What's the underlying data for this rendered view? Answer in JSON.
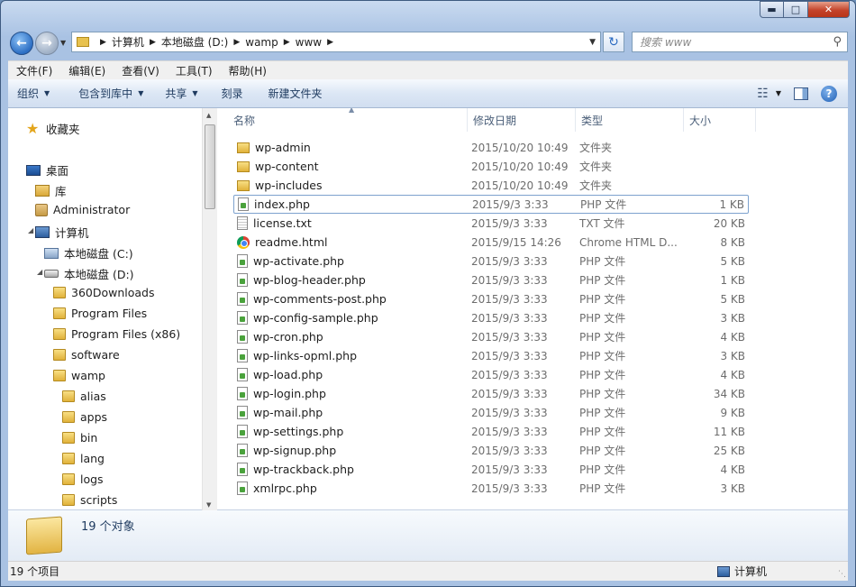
{
  "window": {
    "minimize_icon": "minimize-icon",
    "maximize_icon": "maximize-icon",
    "close_icon": "close-icon"
  },
  "address": {
    "crumbs": [
      "计算机",
      "本地磁盘 (D:)",
      "wamp",
      "www"
    ]
  },
  "search": {
    "placeholder": "搜索 www"
  },
  "menubar": [
    "文件(F)",
    "编辑(E)",
    "查看(V)",
    "工具(T)",
    "帮助(H)"
  ],
  "toolbar": {
    "organize": "组织",
    "include_library": "包含到库中",
    "share": "共享",
    "burn": "刻录",
    "new_folder": "新建文件夹"
  },
  "navpane": {
    "favorites": "收藏夹",
    "desktop": "桌面",
    "libraries": "库",
    "administrator": "Administrator",
    "computer": "计算机",
    "drive_c": "本地磁盘 (C:)",
    "drive_d": "本地磁盘 (D:)",
    "d_folders": [
      "360Downloads",
      "Program Files",
      "Program Files (x86)",
      "software",
      "wamp"
    ],
    "wamp_folders": [
      "alias",
      "apps",
      "bin",
      "lang",
      "logs",
      "scripts"
    ]
  },
  "columns": {
    "name": "名称",
    "date": "修改日期",
    "type": "类型",
    "size": "大小"
  },
  "files": [
    {
      "icon": "folder",
      "name": "wp-admin",
      "date": "2015/10/20 10:49",
      "type": "文件夹",
      "size": ""
    },
    {
      "icon": "folder",
      "name": "wp-content",
      "date": "2015/10/20 10:49",
      "type": "文件夹",
      "size": ""
    },
    {
      "icon": "folder",
      "name": "wp-includes",
      "date": "2015/10/20 10:49",
      "type": "文件夹",
      "size": ""
    },
    {
      "icon": "php",
      "name": "index.php",
      "date": "2015/9/3 3:33",
      "type": "PHP 文件",
      "size": "1 KB"
    },
    {
      "icon": "txt",
      "name": "license.txt",
      "date": "2015/9/3 3:33",
      "type": "TXT 文件",
      "size": "20 KB"
    },
    {
      "icon": "chrome",
      "name": "readme.html",
      "date": "2015/9/15 14:26",
      "type": "Chrome HTML D...",
      "size": "8 KB"
    },
    {
      "icon": "php",
      "name": "wp-activate.php",
      "date": "2015/9/3 3:33",
      "type": "PHP 文件",
      "size": "5 KB"
    },
    {
      "icon": "php",
      "name": "wp-blog-header.php",
      "date": "2015/9/3 3:33",
      "type": "PHP 文件",
      "size": "1 KB"
    },
    {
      "icon": "php",
      "name": "wp-comments-post.php",
      "date": "2015/9/3 3:33",
      "type": "PHP 文件",
      "size": "5 KB"
    },
    {
      "icon": "php",
      "name": "wp-config-sample.php",
      "date": "2015/9/3 3:33",
      "type": "PHP 文件",
      "size": "3 KB"
    },
    {
      "icon": "php",
      "name": "wp-cron.php",
      "date": "2015/9/3 3:33",
      "type": "PHP 文件",
      "size": "4 KB"
    },
    {
      "icon": "php",
      "name": "wp-links-opml.php",
      "date": "2015/9/3 3:33",
      "type": "PHP 文件",
      "size": "3 KB"
    },
    {
      "icon": "php",
      "name": "wp-load.php",
      "date": "2015/9/3 3:33",
      "type": "PHP 文件",
      "size": "4 KB"
    },
    {
      "icon": "php",
      "name": "wp-login.php",
      "date": "2015/9/3 3:33",
      "type": "PHP 文件",
      "size": "34 KB"
    },
    {
      "icon": "php",
      "name": "wp-mail.php",
      "date": "2015/9/3 3:33",
      "type": "PHP 文件",
      "size": "9 KB"
    },
    {
      "icon": "php",
      "name": "wp-settings.php",
      "date": "2015/9/3 3:33",
      "type": "PHP 文件",
      "size": "11 KB"
    },
    {
      "icon": "php",
      "name": "wp-signup.php",
      "date": "2015/9/3 3:33",
      "type": "PHP 文件",
      "size": "25 KB"
    },
    {
      "icon": "php",
      "name": "wp-trackback.php",
      "date": "2015/9/3 3:33",
      "type": "PHP 文件",
      "size": "4 KB"
    },
    {
      "icon": "php",
      "name": "xmlrpc.php",
      "date": "2015/9/3 3:33",
      "type": "PHP 文件",
      "size": "3 KB"
    }
  ],
  "focused_index": 3,
  "details": {
    "count_text": "19 个对象"
  },
  "status": {
    "left": "19 个项目",
    "right": "计算机"
  }
}
